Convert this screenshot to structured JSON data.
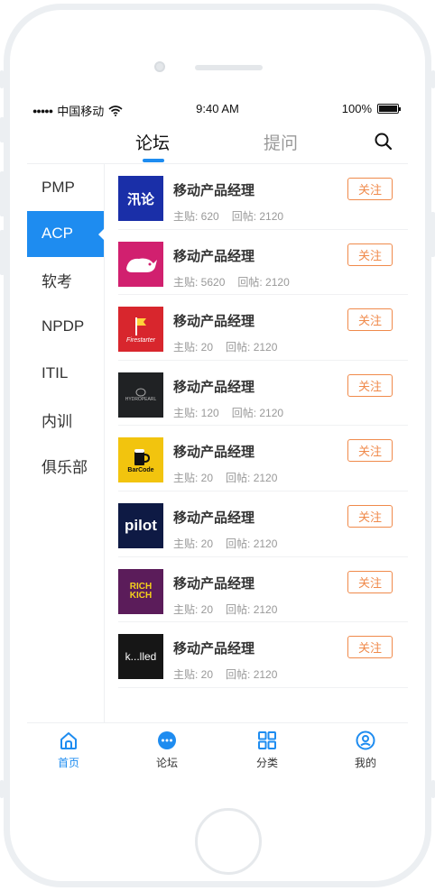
{
  "status_bar": {
    "carrier": "中国移动",
    "signal_dots": "●●●●●",
    "time": "9:40 AM",
    "battery_pct": "100%",
    "icons": [
      "wifi-icon",
      "battery-icon"
    ]
  },
  "top_tabs": [
    {
      "label": "论坛",
      "active": true
    },
    {
      "label": "提问",
      "active": false
    }
  ],
  "search_icon": "search-icon",
  "side_menu": [
    {
      "label": "PMP",
      "active": false
    },
    {
      "label": "ACP",
      "active": true
    },
    {
      "label": "软考",
      "active": false
    },
    {
      "label": "NPDP",
      "active": false
    },
    {
      "label": "ITIL",
      "active": false
    },
    {
      "label": "内训",
      "active": false
    },
    {
      "label": "俱乐部",
      "active": false
    }
  ],
  "forum_list": [
    {
      "title": "移动产品经理",
      "posts": "主贴: 620",
      "replies": "回帖: 2120",
      "follow": "关注",
      "thumb_bg": "#1a2fa8",
      "thumb_text": "汛论"
    },
    {
      "title": "移动产品经理",
      "posts": "主贴: 5620",
      "replies": "回帖: 2120",
      "follow": "关注",
      "thumb_bg": "#d1206f",
      "thumb_text": ""
    },
    {
      "title": "移动产品经理",
      "posts": "主贴: 20",
      "replies": "回帖: 2120",
      "follow": "关注",
      "thumb_bg": "#d8262d",
      "thumb_text": "Firestarter"
    },
    {
      "title": "移动产品经理",
      "posts": "主贴: 120",
      "replies": "回帖: 2120",
      "follow": "关注",
      "thumb_bg": "#202224",
      "thumb_text": "HYDROPEARL"
    },
    {
      "title": "移动产品经理",
      "posts": "主贴: 20",
      "replies": "回帖: 2120",
      "follow": "关注",
      "thumb_bg": "#f2c40e",
      "thumb_text": "BarCode"
    },
    {
      "title": "移动产品经理",
      "posts": "主贴: 20",
      "replies": "回帖: 2120",
      "follow": "关注",
      "thumb_bg": "#0e1a44",
      "thumb_text": "pilot"
    },
    {
      "title": "移动产品经理",
      "posts": "主贴: 20",
      "replies": "回帖: 2120",
      "follow": "关注",
      "thumb_bg": "#5b1c5a",
      "thumb_text": "RICH KICH"
    },
    {
      "title": "移动产品经理",
      "posts": "主贴: 20",
      "replies": "回帖: 2120",
      "follow": "关注",
      "thumb_bg": "#161616",
      "thumb_text": "k...lled"
    }
  ],
  "bottom_nav": [
    {
      "label": "首页",
      "icon": "home-icon",
      "active": true
    },
    {
      "label": "论坛",
      "icon": "chat-bubble-icon",
      "active": false
    },
    {
      "label": "分类",
      "icon": "grid-icon",
      "active": false
    },
    {
      "label": "我的",
      "icon": "profile-icon",
      "active": false
    }
  ],
  "colors": {
    "accent": "#1e8cf0",
    "follow": "#f08a4b",
    "frame": "#eceff2",
    "muted_text": "#999999"
  }
}
